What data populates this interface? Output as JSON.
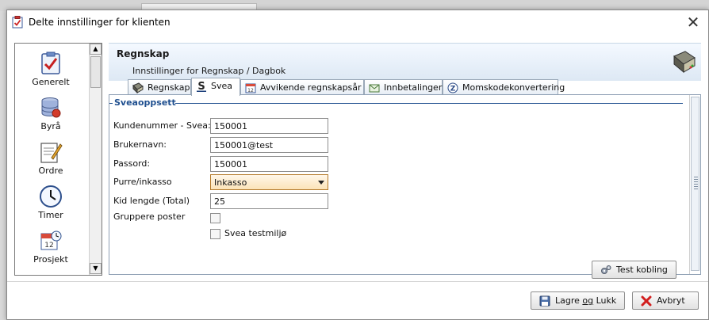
{
  "window": {
    "title": "Delte innstillinger for klienten"
  },
  "sidebar": {
    "items": [
      {
        "label": "Generelt",
        "icon": "checklist-icon"
      },
      {
        "label": "Byrå",
        "icon": "database-icon"
      },
      {
        "label": "Ordre",
        "icon": "order-pen-icon"
      },
      {
        "label": "Timer",
        "icon": "clock-icon"
      },
      {
        "label": "Prosjekt",
        "icon": "calendar-clock-icon"
      }
    ]
  },
  "main": {
    "title": "Regnskap",
    "subtitle": "Innstillinger for Regnskap / Dagbok"
  },
  "tabs": [
    {
      "label": "Regnskap",
      "icon": "book-icon",
      "active": false
    },
    {
      "label": "Svea",
      "icon": "svea-s-icon",
      "active": true
    },
    {
      "label": "Avvikende regnskapsår",
      "icon": "calendar-icon",
      "active": false
    },
    {
      "label": "Innbetalinger",
      "icon": "envelope-icon",
      "active": false
    },
    {
      "label": "Momskodekonvertering",
      "icon": "z-circle-icon",
      "active": false
    }
  ],
  "svea": {
    "group_title": "Sveaoppsett",
    "kundenummer": {
      "label": "Kundenummer - Svea:",
      "value": "150001"
    },
    "brukernavn": {
      "label": "Brukernavn:",
      "value": "150001@test"
    },
    "passord": {
      "label": "Passord:",
      "value": "150001"
    },
    "purre": {
      "label": "Purre/inkasso",
      "value": "Inkasso"
    },
    "kid": {
      "label": "Kid lengde (Total)",
      "value": "25"
    },
    "gruppere": {
      "label": "Gruppere poster",
      "checked": false
    },
    "testmiljo": {
      "label": "Svea testmiljø",
      "checked": false
    },
    "test_button": "Test kobling"
  },
  "footer": {
    "save_label_pre": "Lagre ",
    "save_label_underlined": "og",
    "save_label_post": " Lukk",
    "cancel_label": "Avbryt"
  },
  "colors": {
    "accent": "#1f4f8f",
    "select_bg": "#fbe3b8",
    "header_bg": "#dde8f4"
  }
}
